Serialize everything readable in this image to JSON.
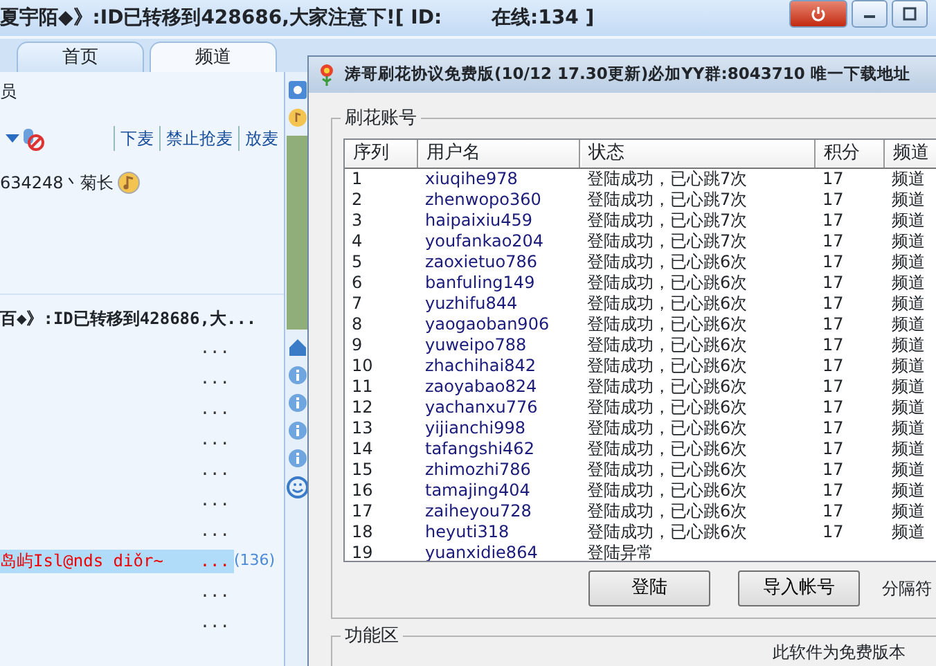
{
  "main_window": {
    "title": "夏宇陌◆》:ID已转移到428686,大家注意下![ ID:",
    "online": "在线:134 ]",
    "tabs": [
      {
        "label": "首页",
        "selected": false
      },
      {
        "label": "频道",
        "selected": true
      }
    ],
    "header_label": "员",
    "toolbar": [
      "下麦",
      "禁止抢麦",
      "放麦"
    ],
    "user": "634248丶菊长",
    "announcement": "百◆》:ID已转移到428686,大...",
    "list": [
      {
        "more": "...",
        "selected": false
      },
      {
        "more": "...",
        "selected": false
      },
      {
        "more": "...",
        "selected": false
      },
      {
        "more": "...",
        "selected": false
      },
      {
        "more": "...",
        "selected": false
      },
      {
        "more": "...",
        "selected": false
      },
      {
        "more": "...",
        "selected": false
      },
      {
        "name": "岛屿Isl@nds diǒr~",
        "more": "...",
        "count": "(136)",
        "selected": true
      },
      {
        "more": "...",
        "selected": false
      },
      {
        "more": "...",
        "selected": false
      }
    ]
  },
  "dialog": {
    "title": "涛哥刷花协议免费版(10/12 17.30更新)必加YY群:8043710 唯一下载地址",
    "accounts_group": "刷花账号",
    "columns": [
      "序列",
      "用户名",
      "状态",
      "积分",
      "频道"
    ],
    "rows": [
      [
        "1",
        "xiuqihe978",
        "登陆成功，已心跳7次",
        "17",
        "频道"
      ],
      [
        "2",
        "zhenwopo360",
        "登陆成功，已心跳7次",
        "17",
        "频道"
      ],
      [
        "3",
        "haipaixiu459",
        "登陆成功，已心跳7次",
        "17",
        "频道"
      ],
      [
        "4",
        "youfankao204",
        "登陆成功，已心跳7次",
        "17",
        "频道"
      ],
      [
        "5",
        "zaoxietuo786",
        "登陆成功，已心跳6次",
        "17",
        "频道"
      ],
      [
        "6",
        "banfuling149",
        "登陆成功，已心跳6次",
        "17",
        "频道"
      ],
      [
        "7",
        "yuzhifu844",
        "登陆成功，已心跳6次",
        "17",
        "频道"
      ],
      [
        "8",
        "yaogaoban906",
        "登陆成功，已心跳6次",
        "17",
        "频道"
      ],
      [
        "9",
        "yuweipo788",
        "登陆成功，已心跳6次",
        "17",
        "频道"
      ],
      [
        "10",
        "zhachihai842",
        "登陆成功，已心跳6次",
        "17",
        "频道"
      ],
      [
        "11",
        "zaoyabao824",
        "登陆成功，已心跳6次",
        "17",
        "频道"
      ],
      [
        "12",
        "yachanxu776",
        "登陆成功，已心跳6次",
        "17",
        "频道"
      ],
      [
        "13",
        "yijianchi998",
        "登陆成功，已心跳6次",
        "17",
        "频道"
      ],
      [
        "14",
        "tafangshi462",
        "登陆成功，已心跳6次",
        "17",
        "频道"
      ],
      [
        "15",
        "zhimozhi786",
        "登陆成功，已心跳6次",
        "17",
        "频道"
      ],
      [
        "16",
        "tamajing404",
        "登陆成功，已心跳6次",
        "17",
        "频道"
      ],
      [
        "17",
        "zaiheyou728",
        "登陆成功，已心跳6次",
        "17",
        "频道"
      ],
      [
        "18",
        "heyuti318",
        "登陆成功，已心跳6次",
        "17",
        "频道"
      ],
      [
        "19",
        "yuanxidie864",
        "登陆异常"
      ]
    ],
    "buttons": [
      "登陆",
      "导入帐号"
    ],
    "separator_label": "分隔符",
    "function_group": "功能区",
    "notice": "此软件为免费版本"
  }
}
